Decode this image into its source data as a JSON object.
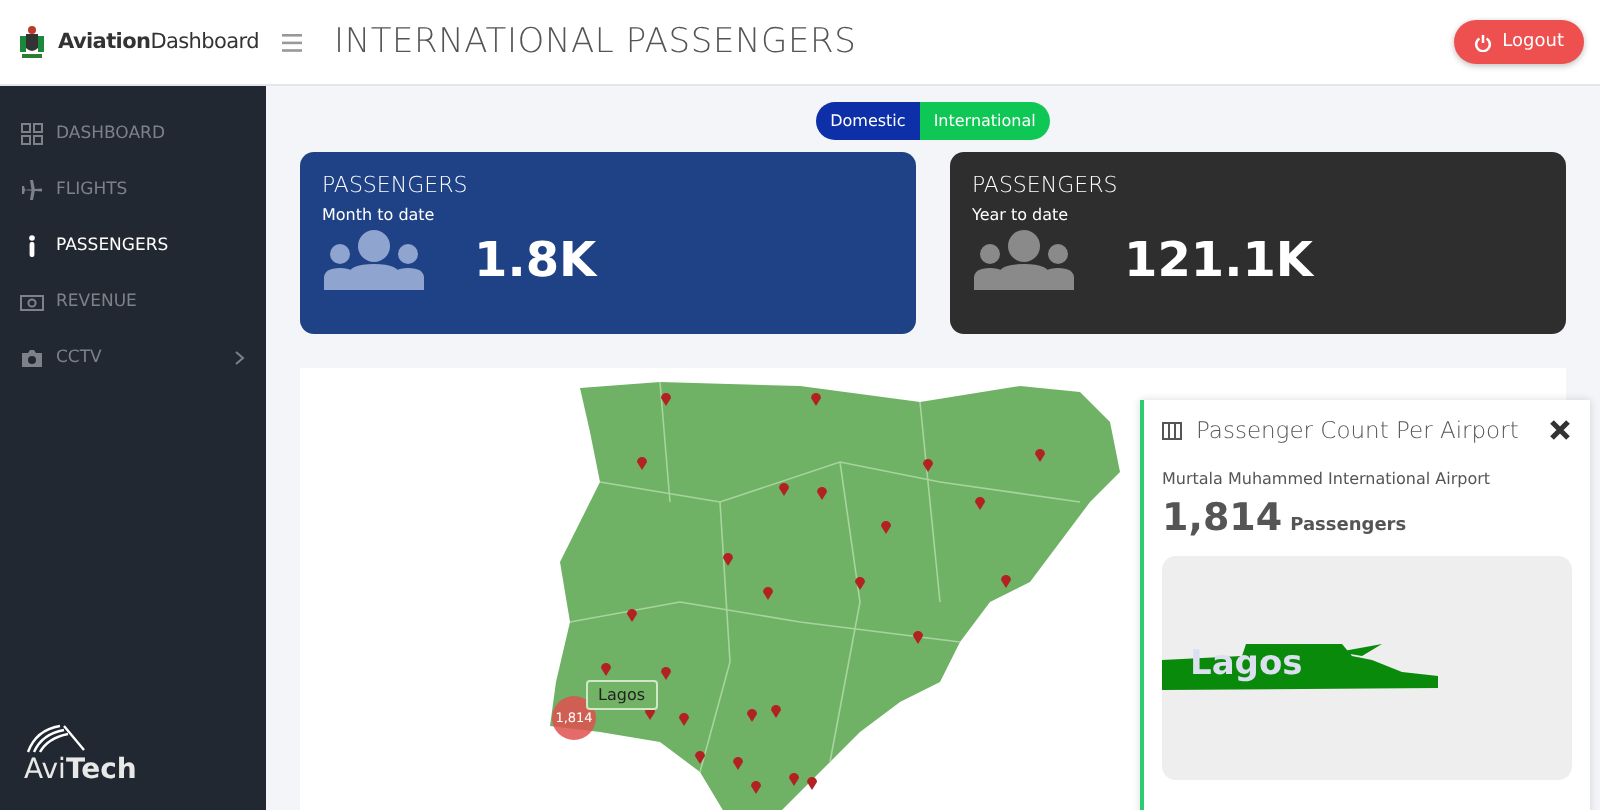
{
  "header": {
    "brand": "**Aviation**Dashboard",
    "title": "INTERNATIONAL PASSENGERS",
    "logout": "Logout"
  },
  "sidebar": {
    "items": [
      {
        "label": "DASHBOARD",
        "kind": "grid",
        "selected": false,
        "expandable": false
      },
      {
        "label": "FLIGHTS",
        "kind": "plane",
        "selected": false,
        "expandable": false
      },
      {
        "label": "PASSENGERS",
        "kind": "person",
        "selected": true,
        "expandable": false
      },
      {
        "label": "REVENUE",
        "kind": "money",
        "selected": false,
        "expandable": false
      },
      {
        "label": "CCTV",
        "kind": "camera",
        "selected": false,
        "expandable": true
      }
    ],
    "logo": "Avi**Tech**"
  },
  "toggle": [
    {
      "label": "Domestic",
      "selected": false
    },
    {
      "label": "International",
      "selected": true
    }
  ],
  "cards": [
    {
      "title": "PASSENGERS",
      "subtitle": "Month to date",
      "value": "1.8K",
      "color": "#1f4185"
    },
    {
      "title": "PASSENGERS",
      "subtitle": "Year to date",
      "value": "121.1K",
      "color": "#2e2e2e"
    }
  ],
  "map": {
    "marker_label": "Lagos",
    "marker_value": "1,814"
  },
  "popup": {
    "title": "Passenger Count Per Airport",
    "airport": "Murtala Muhammed International Airport",
    "count": "1,814",
    "unit": "Passengers",
    "state_label": "Lagos"
  }
}
